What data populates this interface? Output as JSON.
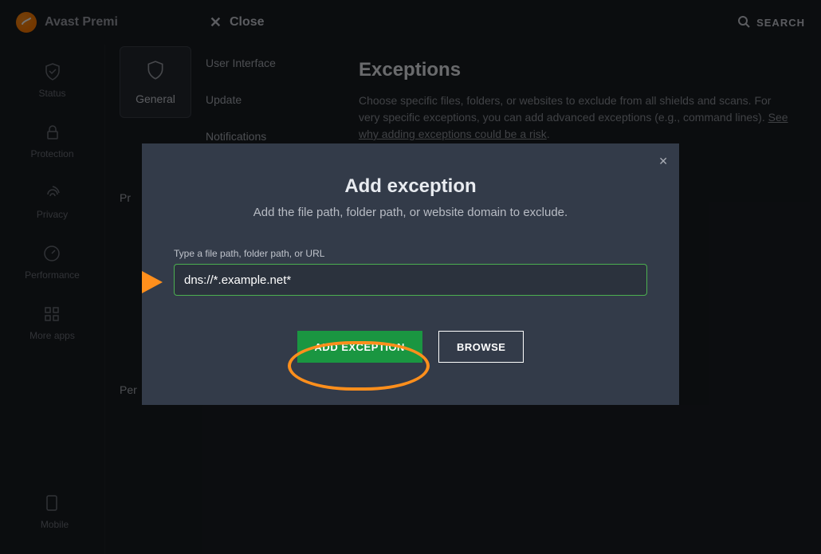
{
  "brand": {
    "name": "Avast Premi"
  },
  "topbar": {
    "close": "Close",
    "search": "SEARCH"
  },
  "leftnav": [
    {
      "key": "status",
      "label": "Status"
    },
    {
      "key": "protection",
      "label": "Protection"
    },
    {
      "key": "privacy",
      "label": "Privacy"
    },
    {
      "key": "performance",
      "label": "Performance"
    },
    {
      "key": "moreapps",
      "label": "More apps"
    }
  ],
  "leftnav_mobile": "Mobile",
  "settings": {
    "general_label": "General",
    "subtabs": [
      "User Interface",
      "Update",
      "Notifications"
    ],
    "side_pr": "Pr",
    "side_per": "Per"
  },
  "content": {
    "title": "Exceptions",
    "desc1": "Choose specific files, folders, or websites to exclude from all shields and scans. For very specific exceptions, you can add advanced exceptions (e.g., command lines).",
    "link": "See why adding exceptions could be a risk",
    "period": "."
  },
  "modal": {
    "title": "Add exception",
    "subtitle": "Add the file path, folder path, or website domain to exclude.",
    "field_label": "Type a file path, folder path, or URL",
    "field_value": "dns://*.example.net*",
    "add_btn": "ADD EXCEPTION",
    "browse_btn": "BROWSE"
  }
}
